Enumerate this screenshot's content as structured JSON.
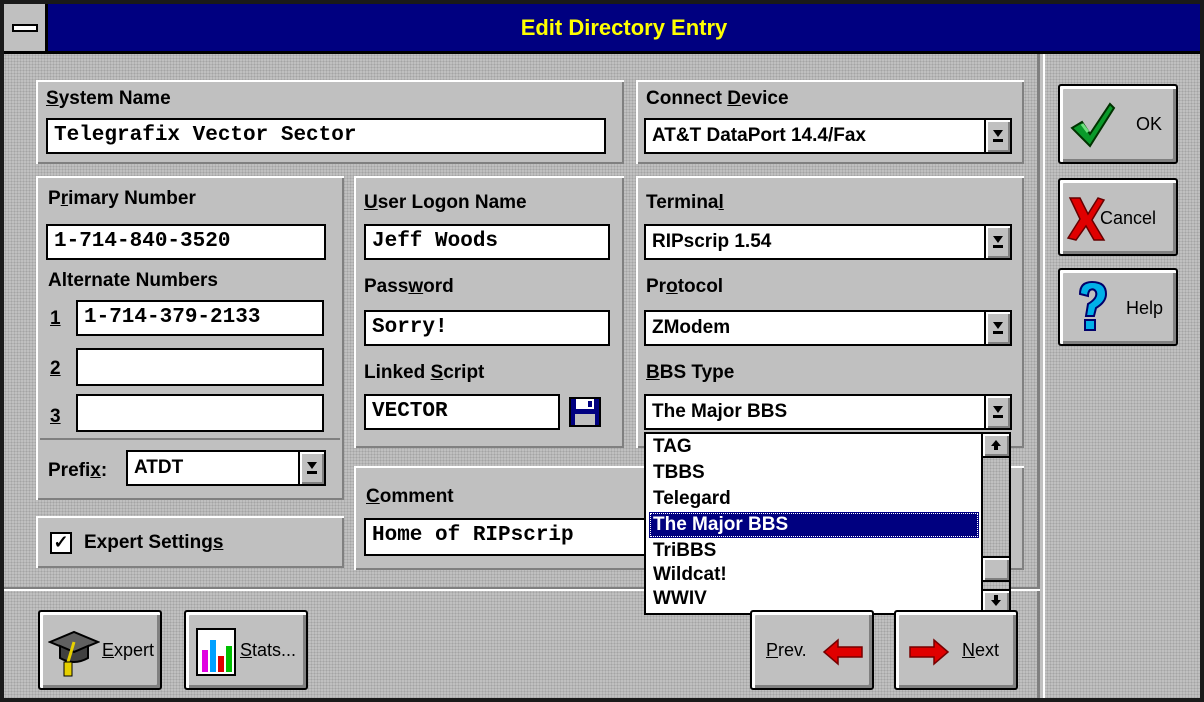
{
  "window": {
    "title": "Edit Directory Entry"
  },
  "system_name": {
    "label_u": "S",
    "label_rest": "ystem Name",
    "value": "Telegrafix Vector Sector"
  },
  "connect_device": {
    "label_pre": "Connect ",
    "label_u": "D",
    "label_rest": "evice",
    "value": "AT&T DataPort 14.4/Fax"
  },
  "primary_number": {
    "label_pre": "P",
    "label_u": "r",
    "label_rest": "imary Number",
    "value": "1-714-840-3520"
  },
  "alternate_numbers": {
    "label": "Alternate Numbers",
    "items": [
      {
        "index": "1",
        "value": "1-714-379-2133"
      },
      {
        "index": "2",
        "value": ""
      },
      {
        "index": "3",
        "value": ""
      }
    ]
  },
  "prefix": {
    "label_pre": "Prefi",
    "label_u": "x",
    "label_rest": ":",
    "value": "ATDT"
  },
  "user_logon": {
    "label_u": "U",
    "label_rest": "ser Logon Name",
    "value": "Jeff Woods"
  },
  "password": {
    "label_pre": "Pass",
    "label_u": "w",
    "label_rest": "ord",
    "value": "Sorry!"
  },
  "linked_script": {
    "label_pre": "Linked ",
    "label_u": "S",
    "label_rest": "cript",
    "value": "VECTOR"
  },
  "terminal": {
    "label_pre": "Termina",
    "label_u": "l",
    "label_rest": "",
    "value": "RIPscrip 1.54"
  },
  "protocol": {
    "label_pre": "Pr",
    "label_u": "o",
    "label_rest": "tocol",
    "value": "ZModem"
  },
  "bbs_type": {
    "label_u": "B",
    "label_rest": "BS Type",
    "value": "The Major BBS",
    "options": [
      "TAG",
      "TBBS",
      "Telegard",
      "The Major BBS",
      "TriBBS",
      "Wildcat!",
      "WWIV"
    ],
    "selected": "The Major BBS"
  },
  "comment": {
    "label_u": "C",
    "label_rest": "omment",
    "value": "Home of RIPscrip"
  },
  "expert_settings": {
    "label_pre": "Expert Setting",
    "label_u": "s",
    "label_rest": "",
    "checked": true,
    "check_glyph": "✓"
  },
  "buttons": {
    "ok": "OK",
    "cancel": "Cancel",
    "help": "Help",
    "expert_u": "E",
    "expert_rest": "xpert",
    "stats_u": "S",
    "stats_rest": "tats...",
    "prev_u": "P",
    "prev_rest": "rev.",
    "next_u": "N",
    "next_rest": "ext"
  },
  "icons": {
    "ok": "checkmark-icon",
    "cancel": "red-x-icon",
    "help": "question-mark-icon",
    "expert": "graduation-cap-icon",
    "stats": "bar-chart-icon",
    "prev": "left-arrow-icon",
    "next": "right-arrow-icon",
    "script": "floppy-disk-icon"
  },
  "colors": {
    "title_bg": "#000080",
    "title_text": "#ffff00",
    "selection": "#000080",
    "arrow_red": "#e00000"
  }
}
